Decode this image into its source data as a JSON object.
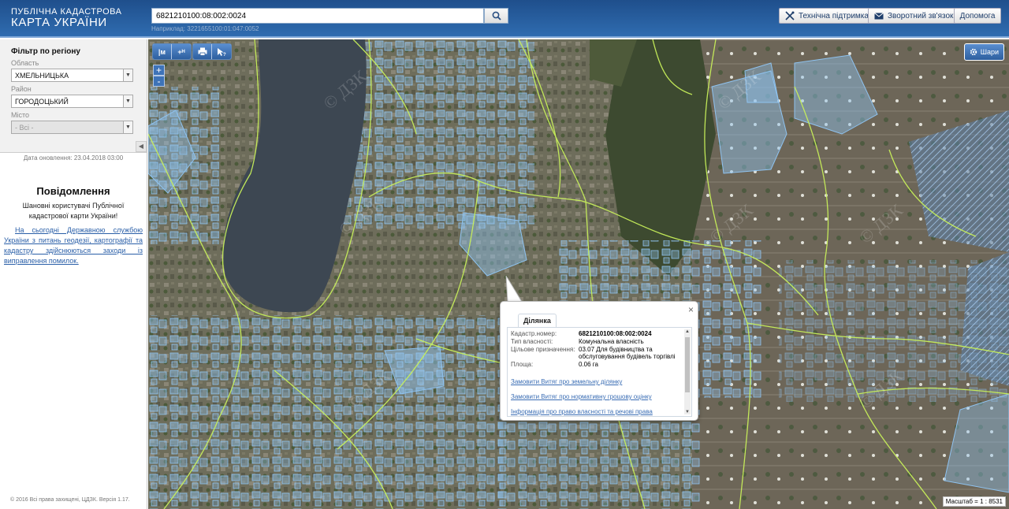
{
  "header": {
    "logo_line1": "ПУБЛІЧНА КАДАСТРОВА",
    "logo_line2": "КАРТА УКРАЇНИ",
    "search_value": "6821210100:08:002:0024",
    "search_hint": "Наприклад: 3221655100:01:047:0052",
    "buttons": {
      "support": "Технічна підтримка",
      "feedback": "Зворотний зв'язок",
      "help": "Допомога"
    }
  },
  "sidebar": {
    "filter_title": "Фільтр по регіону",
    "oblast_label": "Область",
    "oblast_value": "ХМЕЛЬНИЦЬКА",
    "rayon_label": "Район",
    "rayon_value": "ГОРОДОЦЬКИЙ",
    "misto_label": "Місто",
    "misto_value": "- Всі -",
    "collapse_glyph": "◀",
    "updated": "Дата оновлення: 23.04.2018 03:00",
    "notice_title": "Повідомлення",
    "notice_text": "Шановні користувачі Публічної кадастрової карти України!",
    "notice_link": "На сьогодні Державною службою України з питань геодезії, картографії та кадастру здійснюються заходи із виправлення помилок.",
    "copyright": "© 2016 Всі права захищені, ЦДЗК. Версія 1.17."
  },
  "map": {
    "tools": [
      "|м",
      "+ᴴ",
      "print-icon",
      "help-pointer-icon"
    ],
    "zoom_in": "+",
    "zoom_out": "-",
    "layers_label": "Шари",
    "scale_text": "Масштаб = 1 : 8531",
    "watermark": "© ДЗК"
  },
  "popup": {
    "tab": "Ділянка",
    "close": "×",
    "rows": [
      {
        "key": "Кадастр.номер:",
        "value": "6821210100:08:002:0024",
        "bold": true
      },
      {
        "key": "Тип власності:",
        "value": "Комунальна власність"
      },
      {
        "key": "Цільове призначення:",
        "value": "03.07 Для будівництва та обслуговування будівель торгівлі"
      },
      {
        "key": "Площа:",
        "value": "0.06 га"
      }
    ],
    "links": [
      "Замовити Витяг про земельну ділянку",
      "Замовити Витяг про нормативну грошову оцінку",
      "Інформація про право власності та речові права"
    ]
  },
  "colors": {
    "header_blue": "#2f6cb0",
    "parcel_blue": "#8fc3f0",
    "boundary_green": "#c8f05a",
    "water": "#3d4752"
  }
}
